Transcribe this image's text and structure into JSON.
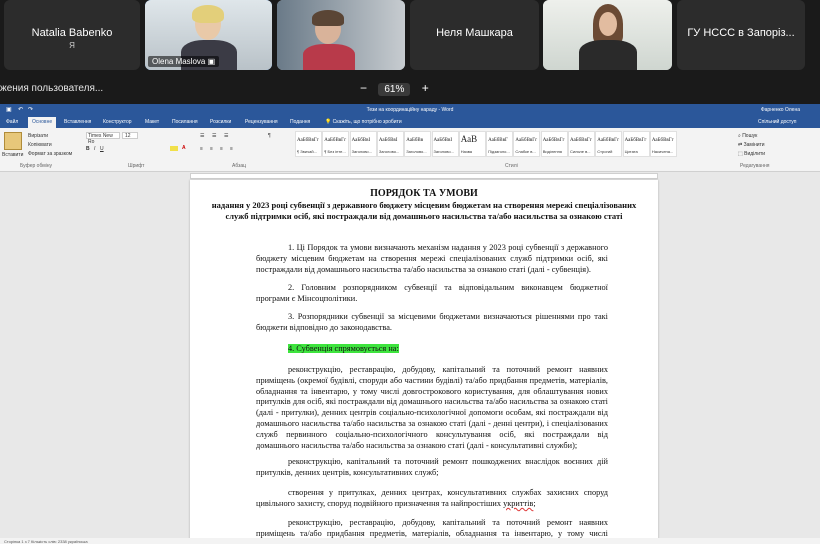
{
  "participants": [
    {
      "name": "Natalia Babenko",
      "sub": "Я",
      "video": false
    },
    {
      "name": "Olena Maslova",
      "video": true,
      "active": true
    },
    {
      "name": "",
      "video": true
    },
    {
      "name": "Неля Машкара",
      "video": false
    },
    {
      "name": "",
      "video": true
    },
    {
      "name": "ГУ НССС в Запоріз...",
      "video": false
    }
  ],
  "share_label": "жения пользователя...",
  "zoom": {
    "minus": "−",
    "value": "61%",
    "plus": "+"
  },
  "word": {
    "title": "Тези на координаційну нараду - Word",
    "user": "Фарненко Олена",
    "share_btn": "Спільний доступ",
    "tabs": [
      "Файл",
      "Основне",
      "Вставлення",
      "Конструктор",
      "Макет",
      "Посилання",
      "Розсилки",
      "Рецензування",
      "Подання"
    ],
    "tell_me": "Скажіть, що потрібно зробити",
    "font_name": "Times New Ro",
    "font_size": "12",
    "paste": "Вставити",
    "groups": [
      "Буфер обміну",
      "Шрифт",
      "Абзац",
      "Стилі",
      "Редагування"
    ],
    "styles": [
      {
        "sample": "АаБбВвГг",
        "label": "¶ Звичай..."
      },
      {
        "sample": "АаБбВвГг",
        "label": "¶ Без інте..."
      },
      {
        "sample": "АаБбВвІ",
        "label": "Заголово..."
      },
      {
        "sample": "АаБбВвІ",
        "label": "Заголово..."
      },
      {
        "sample": "АаБбВв",
        "label": "Заголово..."
      },
      {
        "sample": "АаБбВвІ",
        "label": "Заголово..."
      },
      {
        "sample": "АаВ",
        "label": "Назва"
      },
      {
        "sample": "АаБбВвГ",
        "label": "Підзаголо..."
      },
      {
        "sample": "АаБбВвГг",
        "label": "Слабке в..."
      },
      {
        "sample": "АаБбВвГг",
        "label": "Виділення"
      },
      {
        "sample": "АаБбВвГг",
        "label": "Сильне в..."
      },
      {
        "sample": "АаБбВвГг",
        "label": "Строгий"
      },
      {
        "sample": "АаБбВвГг",
        "label": "Цитата"
      },
      {
        "sample": "АаБбВвГг",
        "label": "Насичена..."
      }
    ],
    "editing": [
      "Пошук",
      "Замінити",
      "Виділити"
    ],
    "clipboard": [
      "Вирізати",
      "Копіювати",
      "Формат за зразком"
    ],
    "status": "Сторінка 1 з 7   Кількість слів: 2338   українська"
  },
  "document": {
    "title": "ПОРЯДОК ТА УМОВИ",
    "subtitle": "надання у 2023 році субвенції з державного бюджету місцевим бюджетам на створення мережі спеціалізованих служб підтримки осіб, які постраждали від домашнього насильства та/або насильства за ознакою статі",
    "p1": "1. Ці Порядок та умови визначають механізм надання у 2023 році субвенції з державного бюджету місцевим бюджетам на створення мережі спеціалізованих служб підтримки осіб, які постраждали від домашнього насильства та/або насильства за ознакою статі (далі - субвенція).",
    "p2": "2. Головним розпорядником субвенції та відповідальним виконавцем бюджетної програми є Мінсоцполітики.",
    "p3": "3. Розпорядники субвенції за місцевими бюджетами визначаються рішеннями про такі бюджети відповідно до законодавства.",
    "p4": "4. Субвенція спрямовується на:",
    "p5": "реконструкцію, реставрацію, добудову, капітальний та поточний ремонт наявних приміщень (окремої будівлі, споруди або частини будівлі) та/або придбання предметів, матеріалів, обладнання та інвентарю, у тому числі довгострокового користування, для облаштування нових притулків для осіб, які постраждали від домашнього насильства та/або насильства за ознакою статі (далі - притулки), денних центрів соціально-психологічної допомоги особам, які постраждали від домашнього насильства та/або насильства за ознакою статі (далі - денні центри), і спеціалізованих служб первинного соціально-психологічного консультування осіб, які постраждали від домашнього насильства та/або насильства за ознакою статі (далі - консультативні служби);",
    "p6": "реконструкцію, капітальний та поточний ремонт пошкоджених внаслідок воєнних дій притулків, денних центрів, консультативних служб;",
    "p7a": "створення у притулках, денних центрах, консультативних службах захисних споруд цивільного захисту, споруд подвійного призначення та найпростіших ",
    "p7b": "укриттів",
    "p7c": ";",
    "p8": "реконструкцію, реставрацію, добудову, капітальний та поточний ремонт наявних приміщень та/або придбання предметів, матеріалів, обладнання та інвентарю, у тому числі довгострокового"
  }
}
